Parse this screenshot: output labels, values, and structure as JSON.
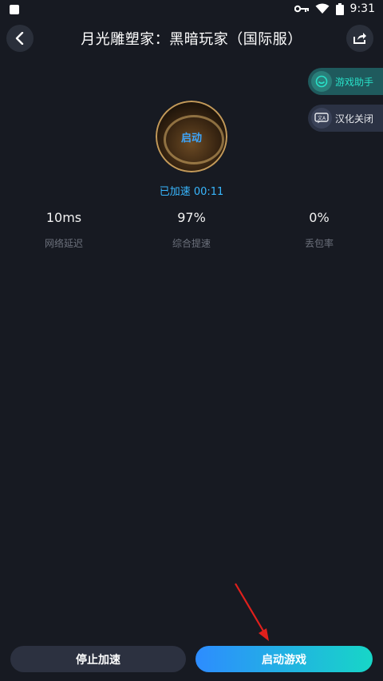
{
  "status_bar": {
    "time": "9:31"
  },
  "header": {
    "title": "月光雕塑家：黑暗玩家（国际服）"
  },
  "side_buttons": {
    "assistant_label": "游戏助手",
    "localize_label": "汉化关闭"
  },
  "game": {
    "avatar_text": "启动",
    "accelerated_label": "已加速 00:11"
  },
  "stats": {
    "ping": {
      "value": "10ms",
      "label": "网络延迟"
    },
    "boost": {
      "value": "97%",
      "label": "综合提速"
    },
    "loss": {
      "value": "0%",
      "label": "丢包率"
    }
  },
  "actions": {
    "stop_label": "停止加速",
    "start_label": "启动游戏"
  },
  "colors": {
    "background": "#171a22",
    "accent_blue": "#38b7ff",
    "accent_teal": "#28e0c8",
    "annotation_arrow": "#e0201c"
  }
}
